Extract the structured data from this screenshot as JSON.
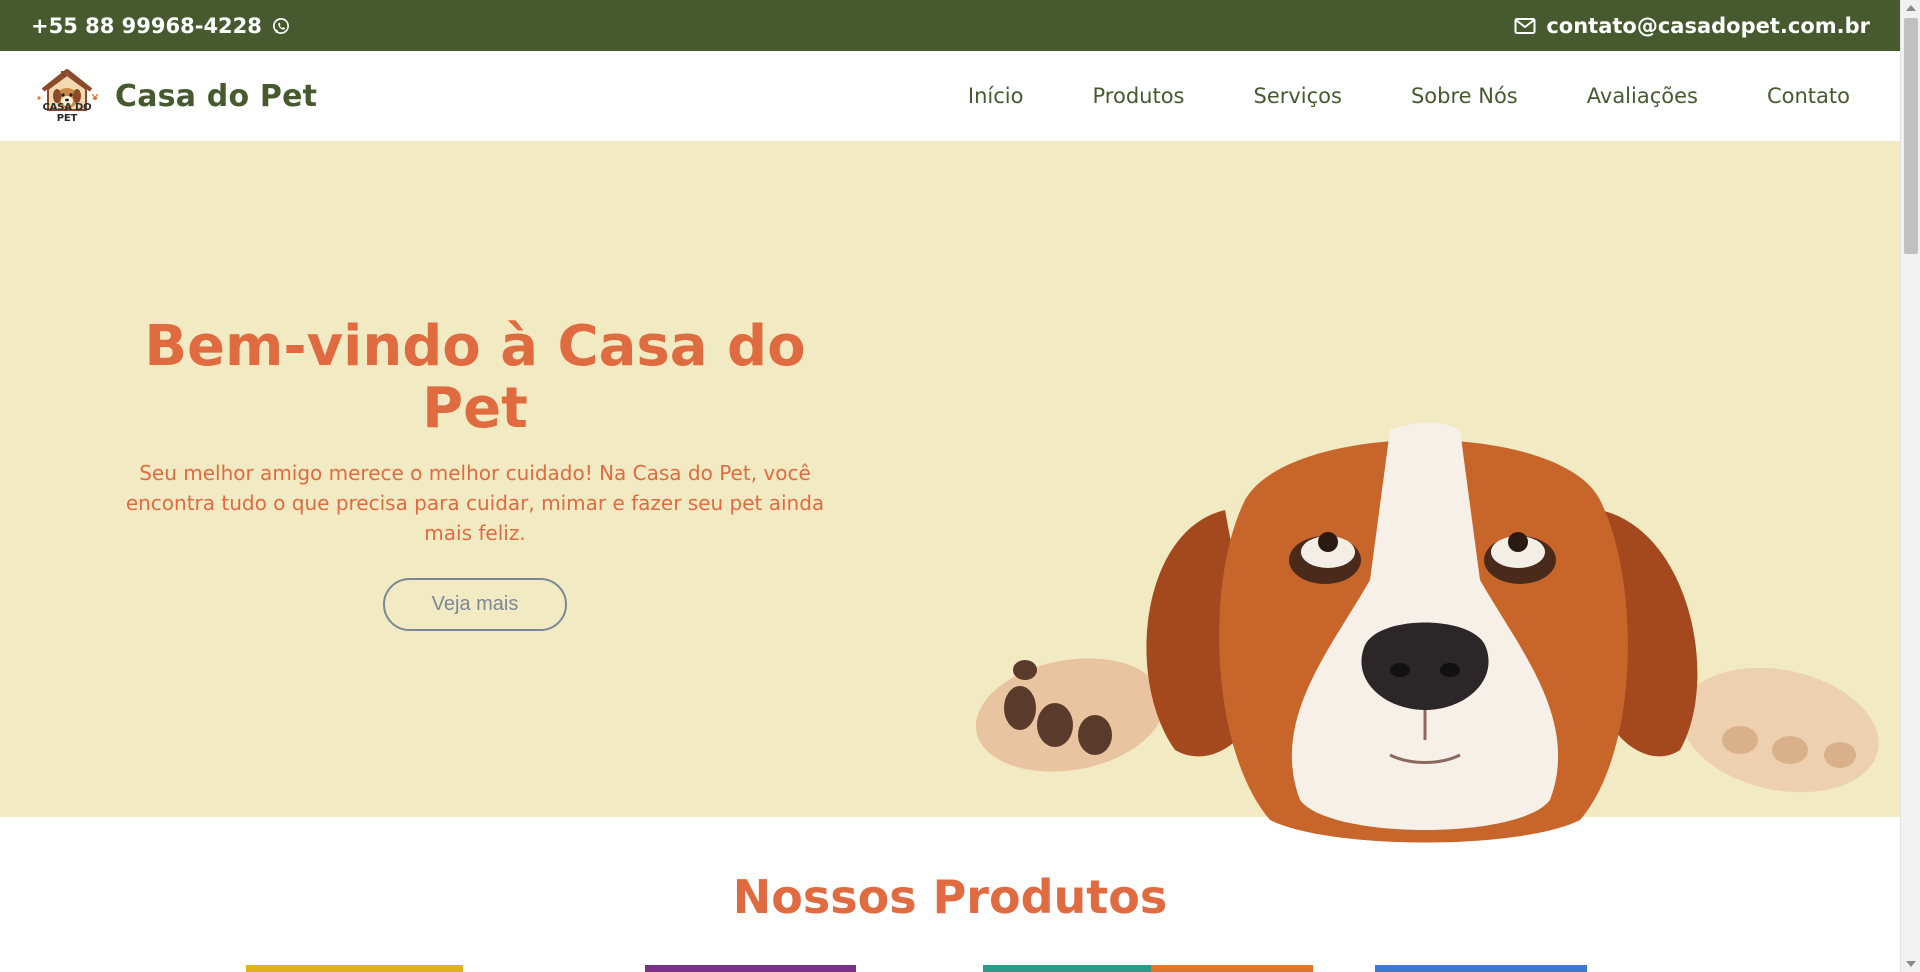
{
  "topbar": {
    "phone": "+55 88 99968-4228",
    "email": "contato@casadopet.com.br",
    "phone_icon": "whatsapp-icon",
    "email_icon": "envelope-icon",
    "bg_color": "#475a2f"
  },
  "brand": {
    "logo_text": "CASA DO PET",
    "title": "Casa do Pet"
  },
  "nav": {
    "items": [
      {
        "label": "Início"
      },
      {
        "label": "Produtos"
      },
      {
        "label": "Serviços"
      },
      {
        "label": "Sobre Nós"
      },
      {
        "label": "Avaliações"
      },
      {
        "label": "Contato"
      }
    ]
  },
  "hero": {
    "title": "Bem-vindo à Casa do Pet",
    "subtitle": "Seu melhor amigo merece o melhor cuidado! Na Casa do Pet, você encontra tudo o que precisa para cuidar, mimar e fazer seu pet ainda mais feliz.",
    "button_label": "Veja mais",
    "image": "beagle-dog-image",
    "bg_color": "#f2eac3",
    "accent_color": "#e06b40"
  },
  "products": {
    "title": "Nossos Produtos"
  }
}
